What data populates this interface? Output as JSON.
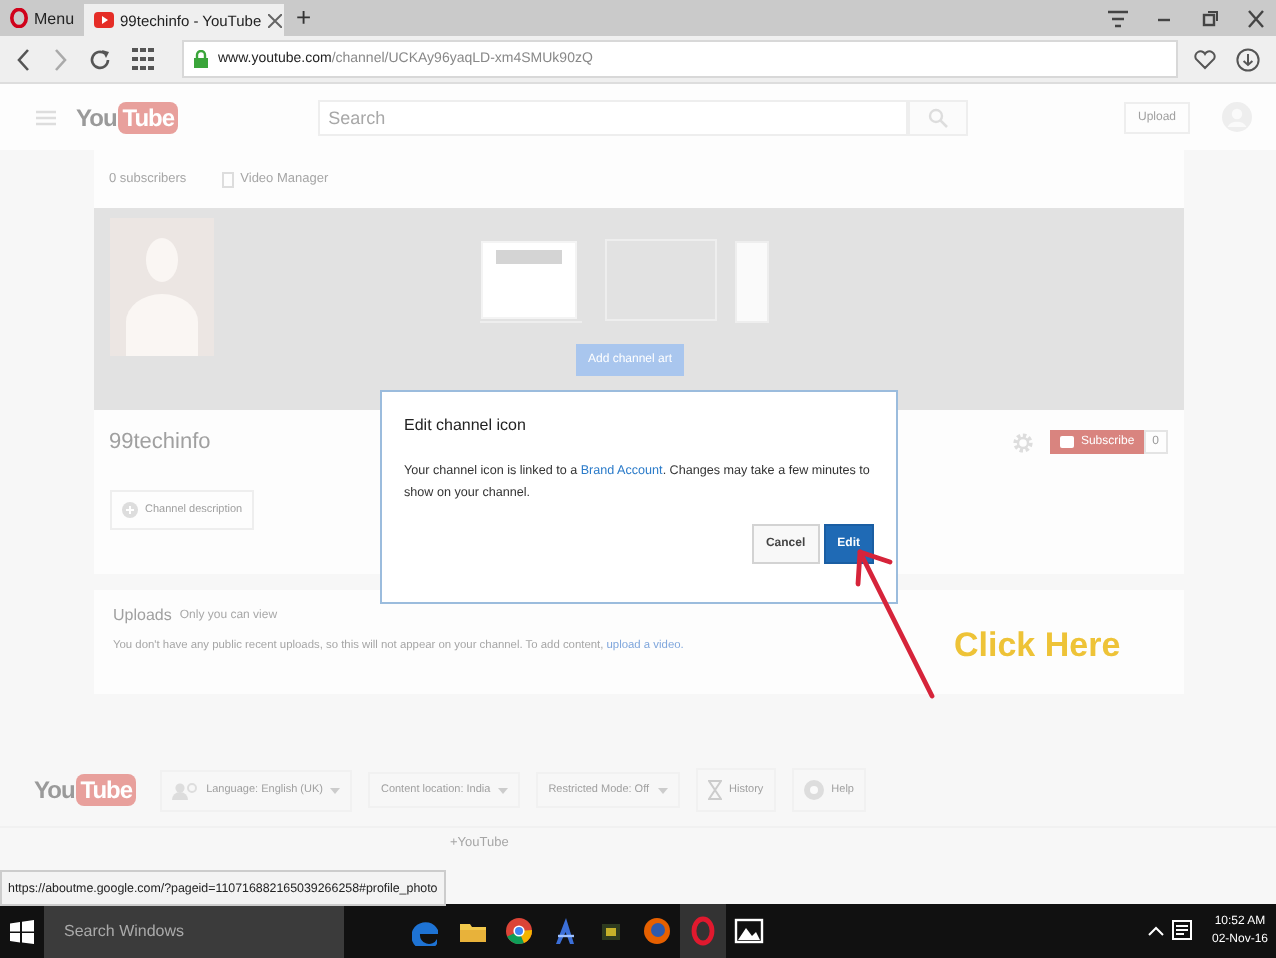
{
  "browser": {
    "menu_label": "Menu",
    "tabs": [
      {
        "title": "99techinfo - YouTube",
        "selected": true
      }
    ],
    "new_tab": "+",
    "url_host": "www.youtube.com",
    "url_path": "/channel/UCKAy96yaqLD-xm4SMUk90zQ"
  },
  "header": {
    "logo": [
      "You",
      "Tube"
    ],
    "search_placeholder": "Search",
    "upload": "Upload"
  },
  "channel_nav": {
    "subscribers": "0 subscribers",
    "video_manager": "Video Manager"
  },
  "banner": {
    "button": "Add channel art"
  },
  "channel": {
    "name": "99techinfo",
    "subscribe": "Subscribe",
    "count": "0",
    "description_button": "Channel description"
  },
  "uploads": {
    "title": "Uploads",
    "note": "Only you can view",
    "message": "You don't have any public recent uploads, so this will not appear on your channel. To add content,",
    "link": "upload a video."
  },
  "footer": {
    "buttons": [
      {
        "label": "Language: English (UK)",
        "kind": "language"
      },
      {
        "label": "Content location: India",
        "kind": "dropdown"
      },
      {
        "label": "Restricted Mode: Off",
        "kind": "dropdown"
      },
      {
        "label": "History",
        "kind": "history"
      },
      {
        "label": "Help",
        "kind": "help"
      }
    ],
    "logo": [
      "You",
      "Tube"
    ],
    "link": "+YouTube"
  },
  "status_url": "https://aboutme.google.com/?pageid=110716882165039266258#profile_photo",
  "dialog": {
    "title": "Edit channel icon",
    "message_before": "Your channel icon is linked to a",
    "link": "Brand Account",
    "message_after": ". Changes may take a few minutes to show on your channel.",
    "buttons": [
      {
        "label": "Cancel",
        "kind": "secondary"
      },
      {
        "label": "Edit",
        "kind": "primary"
      }
    ]
  },
  "annotation": {
    "text": "Click Here"
  },
  "taskbar": {
    "search": "Search Windows",
    "time": "10:52 AM",
    "date": "02-Nov-16"
  }
}
